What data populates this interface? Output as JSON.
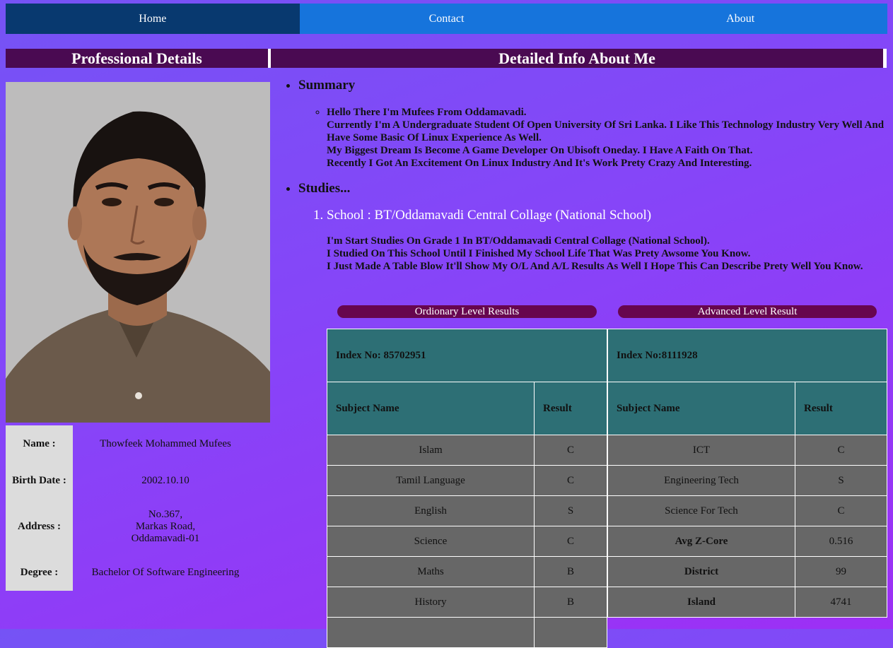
{
  "nav": [
    "Home",
    "Contact",
    "About"
  ],
  "headers": {
    "left": "Professional Details",
    "right": "Detailed Info About Me"
  },
  "colors": {
    "nav_active": "#08396f",
    "nav": "#1674dc",
    "header_bg": "#4a0a52",
    "pill_bg": "#67064f",
    "table_header": "#2d6f75",
    "table_cell": "#676767"
  },
  "profile": {
    "photo_alt": "profile-photo",
    "rows": [
      {
        "label": "Name :",
        "value": "Thowfeek Mohammed Mufees"
      },
      {
        "label": "Birth Date :",
        "value": "2002.10.10"
      },
      {
        "label": "Address :",
        "value_lines": [
          "No.367,",
          "Markas Road,",
          "Oddamavadi-01"
        ]
      },
      {
        "label": "Degree :",
        "value": "Bachelor Of Software Engineering"
      }
    ]
  },
  "summary": {
    "title": "Summary",
    "lines": [
      "Hello There I'm Mufees From Oddamavadi.",
      "Currently I'm A Undergraduate Student Of Open University Of Sri Lanka. I Like This Technology Industry Very Well And Have Some Basic Of Linux Experience As Well.",
      "My Biggest Dream Is Become A Game Developer On Ubisoft Oneday. I Have A Faith On That.",
      "Recently I Got An Excitement On Linux Industry And It's Work Prety Crazy And Interesting."
    ]
  },
  "studies": {
    "title": "Studies...",
    "school": "School : BT/Oddamavadi Central Collage (National School)",
    "lines": [
      "I'm Start Studies On Grade 1 In BT/Oddamavadi Central Collage (National School).",
      "I Studied On This School Until I Finished My School Life That Was Prety Awsome You Know.",
      "I Just Made A Table Blow It'll Show My O/L And A/L Results As Well I Hope This Can Describe Prety Well You Know."
    ]
  },
  "ol": {
    "pill": "Ordionary Level Results",
    "index": "Index No: 85702951",
    "col1": "Subject Name",
    "col2": "Result",
    "rows": [
      [
        "Islam",
        "C"
      ],
      [
        "Tamil Language",
        "C"
      ],
      [
        "English",
        "S"
      ],
      [
        "Science",
        "C"
      ],
      [
        "Maths",
        "B"
      ],
      [
        "History",
        "B"
      ]
    ]
  },
  "al": {
    "pill": "Advanced Level Result",
    "index": "Index No:8111928",
    "col1": "Subject Name",
    "col2": "Result",
    "rows": [
      [
        "ICT",
        "C",
        false
      ],
      [
        "Engineering Tech",
        "S",
        false
      ],
      [
        "Science For Tech",
        "C",
        false
      ],
      [
        "Avg Z-Core",
        "0.516",
        true
      ],
      [
        "District",
        "99",
        true
      ],
      [
        "Island",
        "4741",
        true
      ]
    ]
  }
}
